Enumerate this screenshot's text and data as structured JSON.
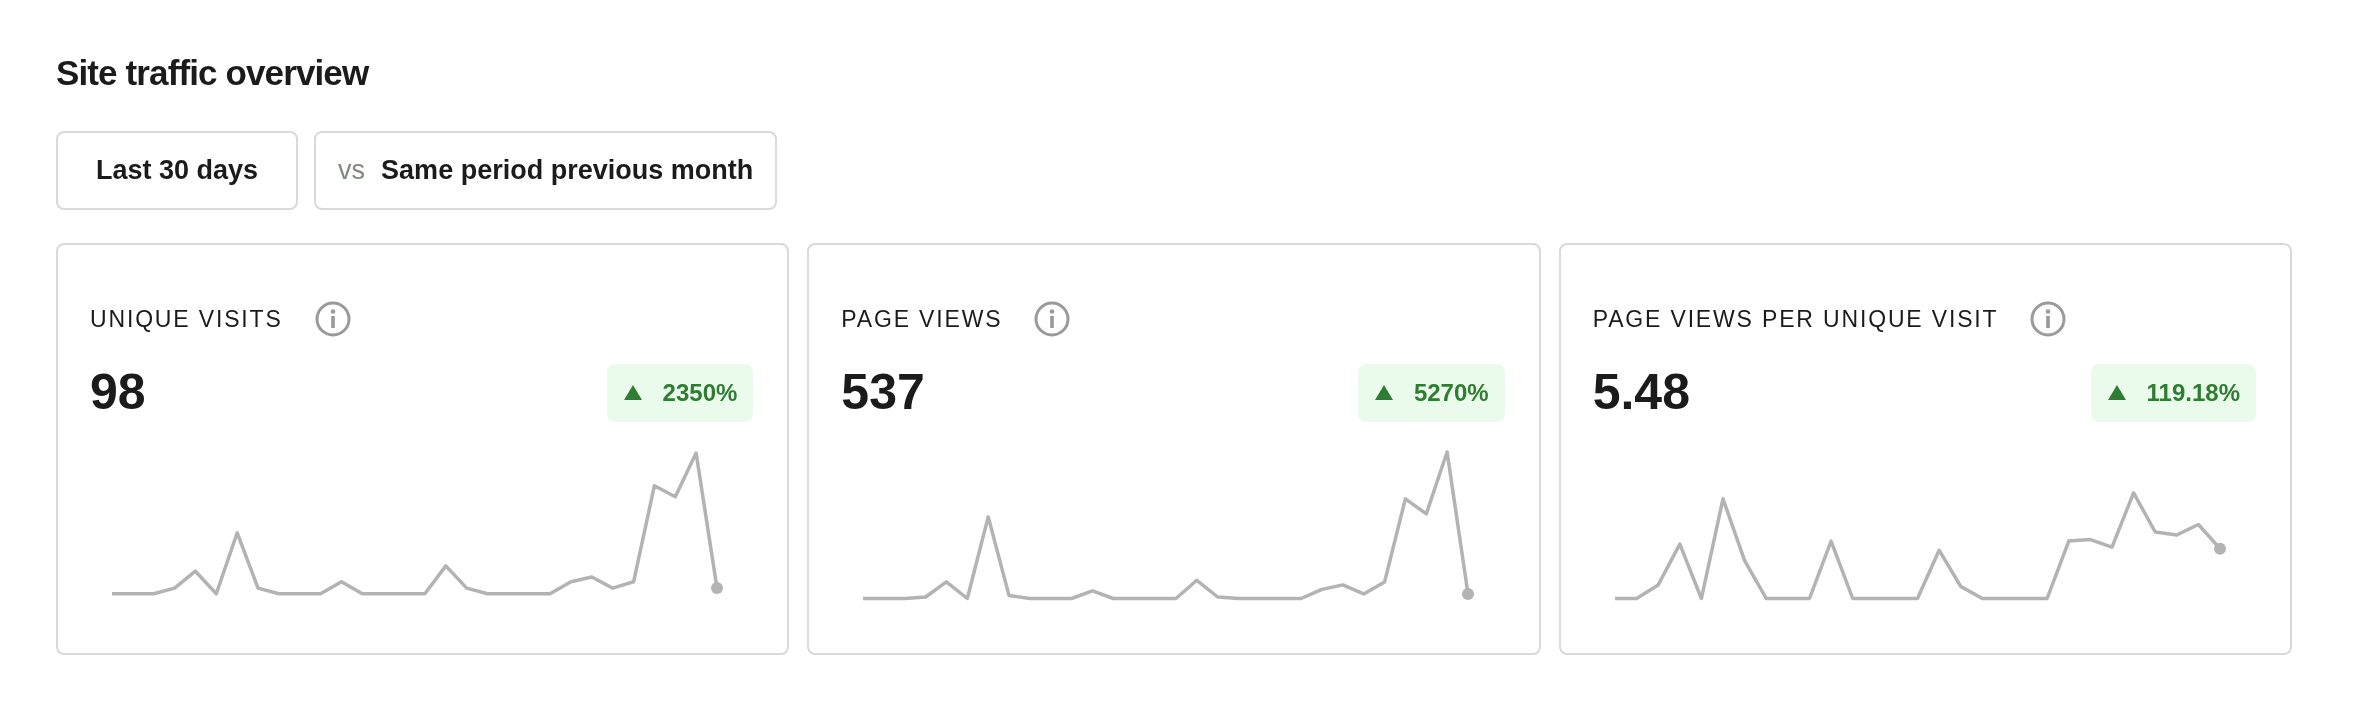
{
  "title": "Site traffic overview",
  "filters": [
    {
      "kind": "period",
      "label": "Last 30 days"
    },
    {
      "kind": "compare",
      "prefix": "vs",
      "label": "Same period previous month"
    }
  ],
  "cards": [
    {
      "label": "UNIQUE VISITS",
      "value": "98",
      "change": "2350%",
      "kind": "increase"
    },
    {
      "label": "PAGE VIEWS",
      "value": "537",
      "change": "5270%",
      "kind": "increase"
    },
    {
      "label": "PAGE VIEWS PER UNIQUE VISIT",
      "value": "5.48",
      "change": "119.18%",
      "kind": "increase"
    }
  ]
}
